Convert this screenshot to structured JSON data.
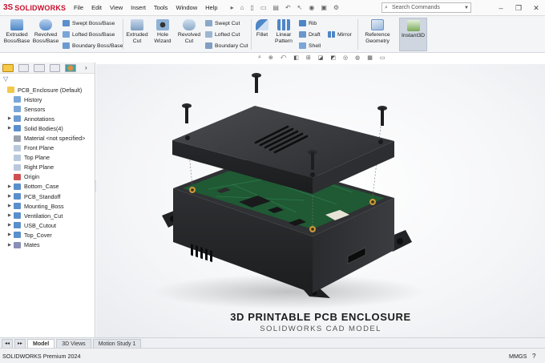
{
  "app": {
    "logo_mark": "3S",
    "logo_text": "SOLIDWORKS"
  },
  "menu": [
    "File",
    "Edit",
    "View",
    "Insert",
    "Tools",
    "Window",
    "Help"
  ],
  "quick_access_icons": [
    "pin-icon",
    "home-icon",
    "new-file-icon",
    "open-icon",
    "print-icon",
    "undo-icon",
    "select-icon",
    "rebuild-icon",
    "save-icon",
    "options-icon"
  ],
  "search": {
    "placeholder": "Search Commands"
  },
  "window_controls": [
    "minimize",
    "maximize",
    "close"
  ],
  "ribbon": {
    "extruded_boss": "Extruded Boss/Base",
    "revolved_boss": "Revolved Boss/Base",
    "swept_boss": "Swept Boss/Base",
    "lofted_boss": "Lofted Boss/Base",
    "boundary_boss": "Boundary Boss/Base",
    "extruded_cut": "Extruded Cut",
    "hole_wizard": "Hole Wizard",
    "revolved_cut": "Revolved Cut",
    "swept_cut": "Swept Cut",
    "lofted_cut": "Lofted Cut",
    "boundary_cut": "Boundary Cut",
    "fillet": "Fillet",
    "linear_pattern": "Linear Pattern",
    "rib": "Rib",
    "draft": "Draft",
    "shell": "Shell",
    "mirror": "Mirror",
    "reference_geometry": "Reference Geometry",
    "instant3d": "Instant3D"
  },
  "fm_tabs": [
    "feature-manager",
    "property-manager",
    "configuration-manager",
    "dimxpert-manager",
    "display-manager"
  ],
  "tree": [
    {
      "label": "PCB_Enclosure  (Default)",
      "expand": false,
      "icon": "part-icon",
      "indent": 0
    },
    {
      "label": "History",
      "expand": false,
      "icon": "history-icon",
      "indent": 1
    },
    {
      "label": "Sensors",
      "expand": false,
      "icon": "sensor-icon",
      "indent": 1
    },
    {
      "label": "Annotations",
      "expand": true,
      "icon": "annotation-icon",
      "indent": 1
    },
    {
      "label": "Solid Bodies(4)",
      "expand": true,
      "icon": "solid-bodies-icon",
      "indent": 1
    },
    {
      "label": "Material <not specified>",
      "expand": false,
      "icon": "material-icon",
      "indent": 1
    },
    {
      "label": "Front Plane",
      "expand": false,
      "icon": "plane-icon",
      "indent": 1
    },
    {
      "label": "Top Plane",
      "expand": false,
      "icon": "plane-icon",
      "indent": 1
    },
    {
      "label": "Right Plane",
      "expand": false,
      "icon": "plane-icon",
      "indent": 1
    },
    {
      "label": "Origin",
      "expand": false,
      "icon": "origin-icon",
      "indent": 1
    },
    {
      "label": "Bottom_Case",
      "expand": true,
      "icon": "feature-icon",
      "indent": 1
    },
    {
      "label": "PCB_Standoff",
      "expand": true,
      "icon": "feature-icon",
      "indent": 1
    },
    {
      "label": "Mounting_Boss",
      "expand": true,
      "icon": "feature-icon",
      "indent": 1
    },
    {
      "label": "Ventilation_Cut",
      "expand": true,
      "icon": "feature-icon",
      "indent": 1
    },
    {
      "label": "USB_Cutout",
      "expand": true,
      "icon": "feature-icon",
      "indent": 1
    },
    {
      "label": "Top_Cover",
      "expand": true,
      "icon": "feature-icon",
      "indent": 1
    },
    {
      "label": "Mates",
      "expand": true,
      "icon": "mates-icon",
      "indent": 1
    }
  ],
  "viewport": {
    "title": "3D PRINTABLE PCB ENCLOSURE",
    "subtitle": "SOLIDWORKS CAD MODEL"
  },
  "bottom_tabs": [
    "Model",
    "3D Views",
    "Motion Study 1"
  ],
  "status": {
    "product": "SOLIDWORKS Premium 2024",
    "units": "MMGS"
  },
  "colors": {
    "brand_red": "#c8102e",
    "case_dark": "#2a2b2e",
    "pcb_green": "#1f5a34",
    "brass": "#c79a3a"
  }
}
